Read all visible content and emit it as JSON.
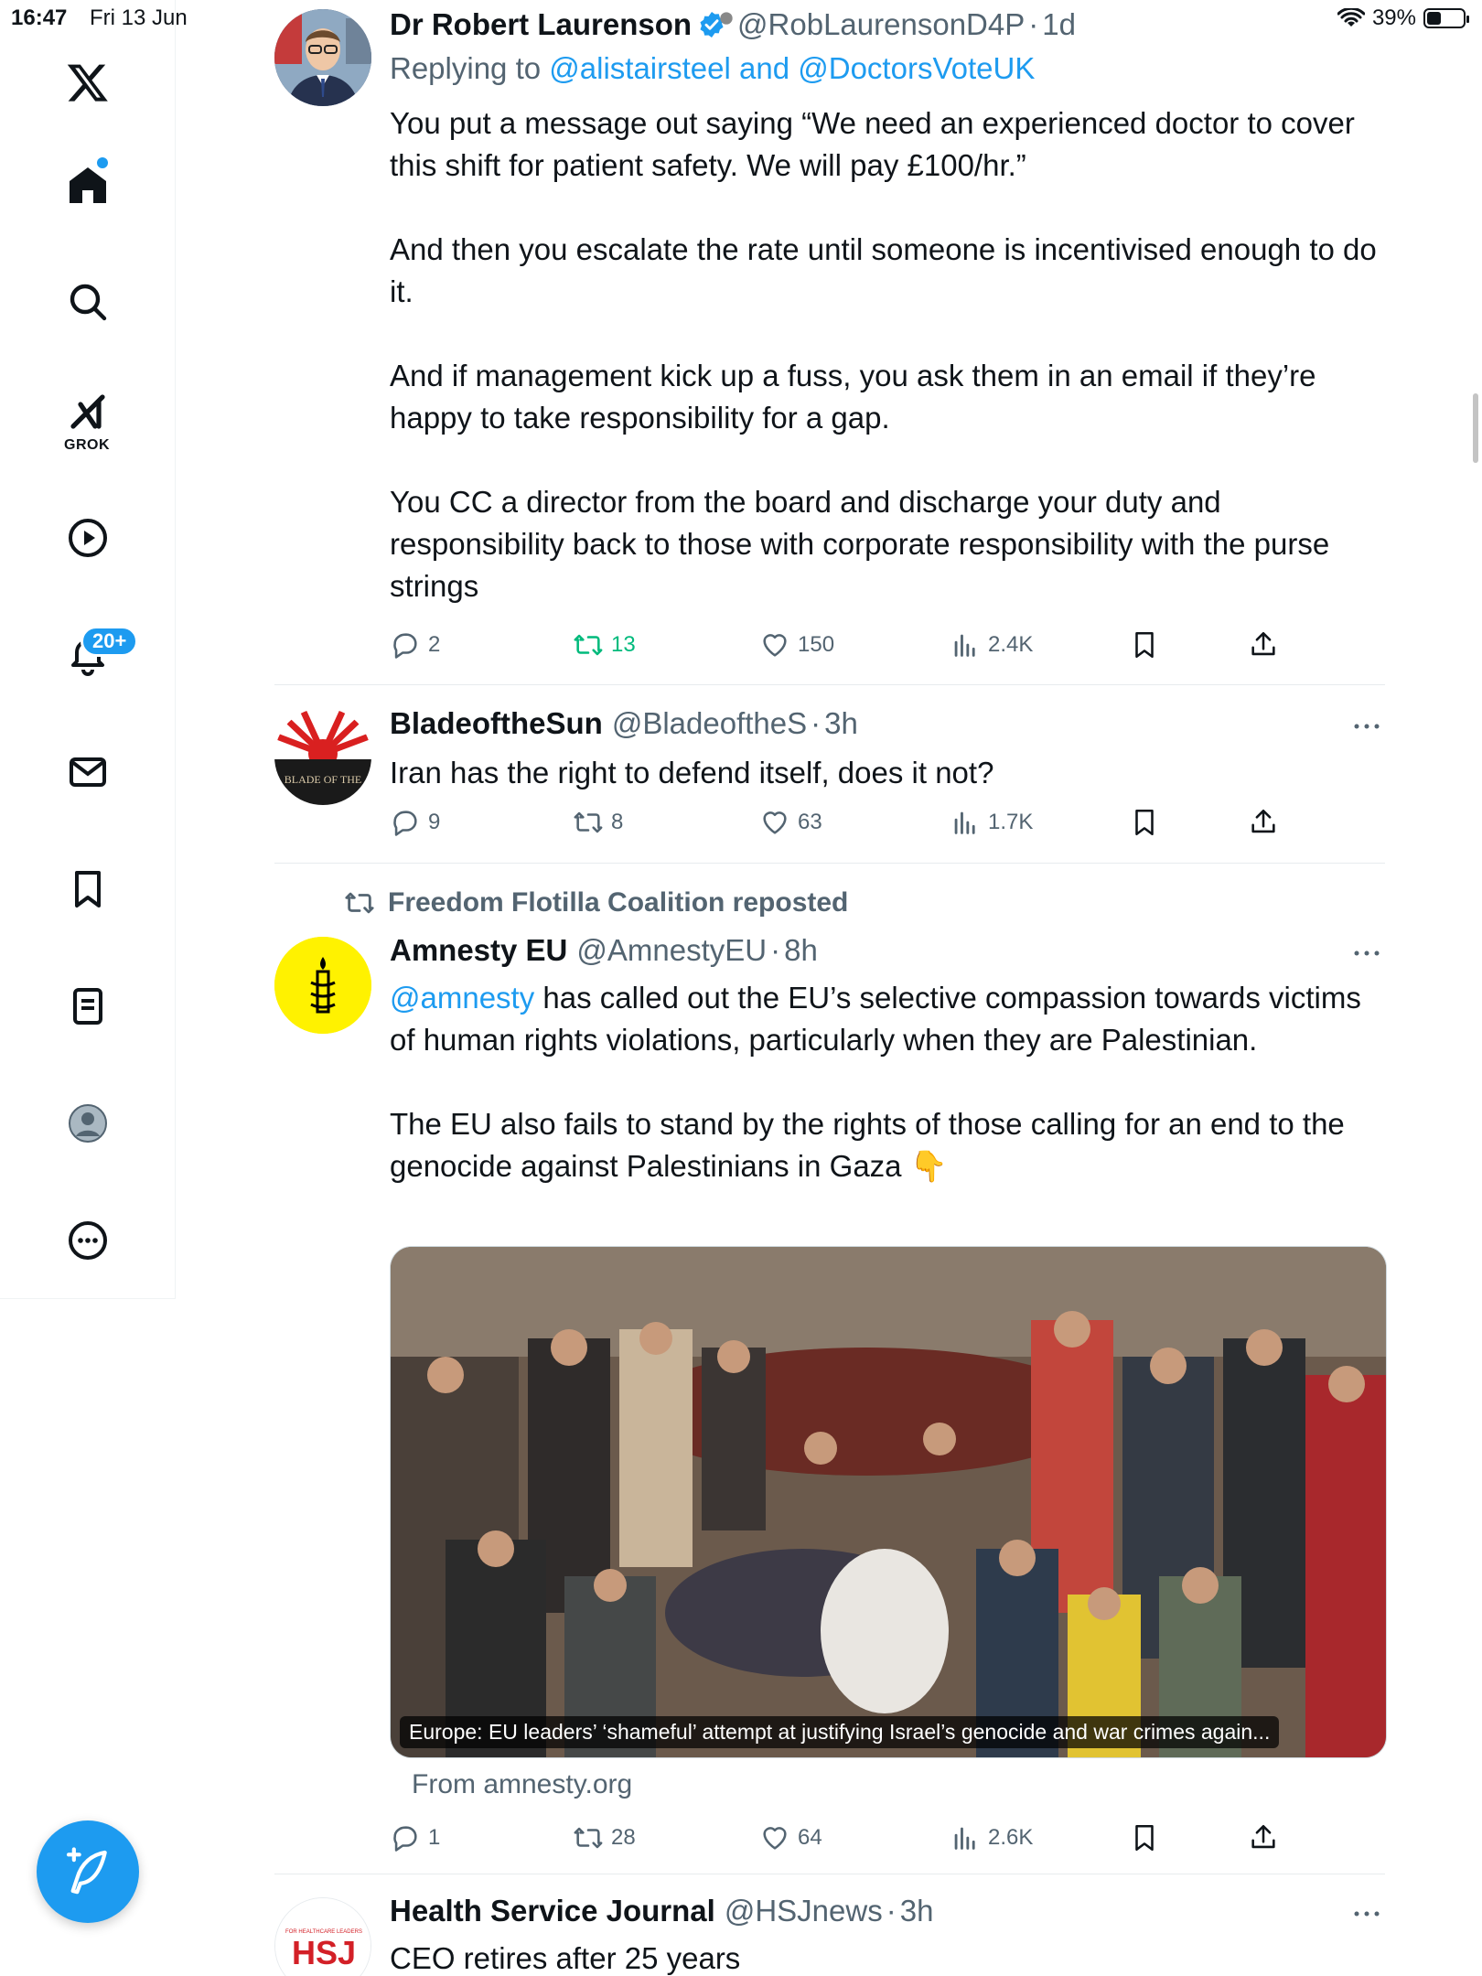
{
  "status_bar": {
    "time": "16:47",
    "date": "Fri 13 Jun",
    "battery": "39%",
    "battery_level": 0.39
  },
  "nav": {
    "grok_label": "GROK",
    "notifications_badge": "20+"
  },
  "colors": {
    "accent": "#1d9bf0",
    "retweet_active": "#00ba7c",
    "secondary_text": "#536471"
  },
  "tweets": [
    {
      "name": "Dr Robert Laurenson",
      "verified": true,
      "handle": "@RobLaurensonD4P",
      "time": "1d",
      "replying_prefix": "Replying to ",
      "replying_to_1": "@alistairsteel",
      "replying_and": " and ",
      "replying_to_2": "@DoctorsVoteUK",
      "paragraphs": [
        "You put a message out saying “We need an experienced doctor to cover this shift for patient safety. We will pay £100/hr.”",
        "And then you escalate the rate until someone is incentivised enough to do it.",
        "And if management kick up a fuss, you ask them in an email if they’re happy to take responsibility for a gap.",
        "You CC a director from the board and discharge your duty and responsibility back to those with corporate responsibility with the purse strings"
      ],
      "replies": "2",
      "retweets": "13",
      "likes": "150",
      "views": "2.4K"
    },
    {
      "name": "BladeoftheSun",
      "handle": "@BladeoftheS",
      "time": "3h",
      "avatar_text": "BLADE OF THE",
      "text": "Iran has the right to defend itself, does it not?",
      "replies": "9",
      "retweets": "8",
      "likes": "63",
      "views": "1.7K"
    },
    {
      "reposted_by": "Freedom Flotilla Coalition reposted",
      "name": "Amnesty EU",
      "handle": "@AmnestyEU",
      "time": "8h",
      "mention": "@amnesty",
      "text_after_mention": " has called out the EU’s selective compassion towards victims of human rights violations, particularly when they are Palestinian.",
      "paragraph_2": "The EU also fails to stand by the rights of those calling for an end to the genocide against Palestinians in Gaza",
      "emoji": "👇",
      "card_caption": "Europe: EU leaders’ ‘shameful’ attempt at justifying Israel’s genocide and war crimes again...",
      "card_source": "From amnesty.org",
      "replies": "1",
      "retweets": "28",
      "likes": "64",
      "views": "2.6K"
    },
    {
      "name": "Health Service Journal",
      "handle": "@HSJnews",
      "time": "3h",
      "avatar_text": "HSJ",
      "avatar_small_text": "FOR HEALTHCARE LEADERS",
      "text": "CEO retires after 25 years"
    }
  ]
}
